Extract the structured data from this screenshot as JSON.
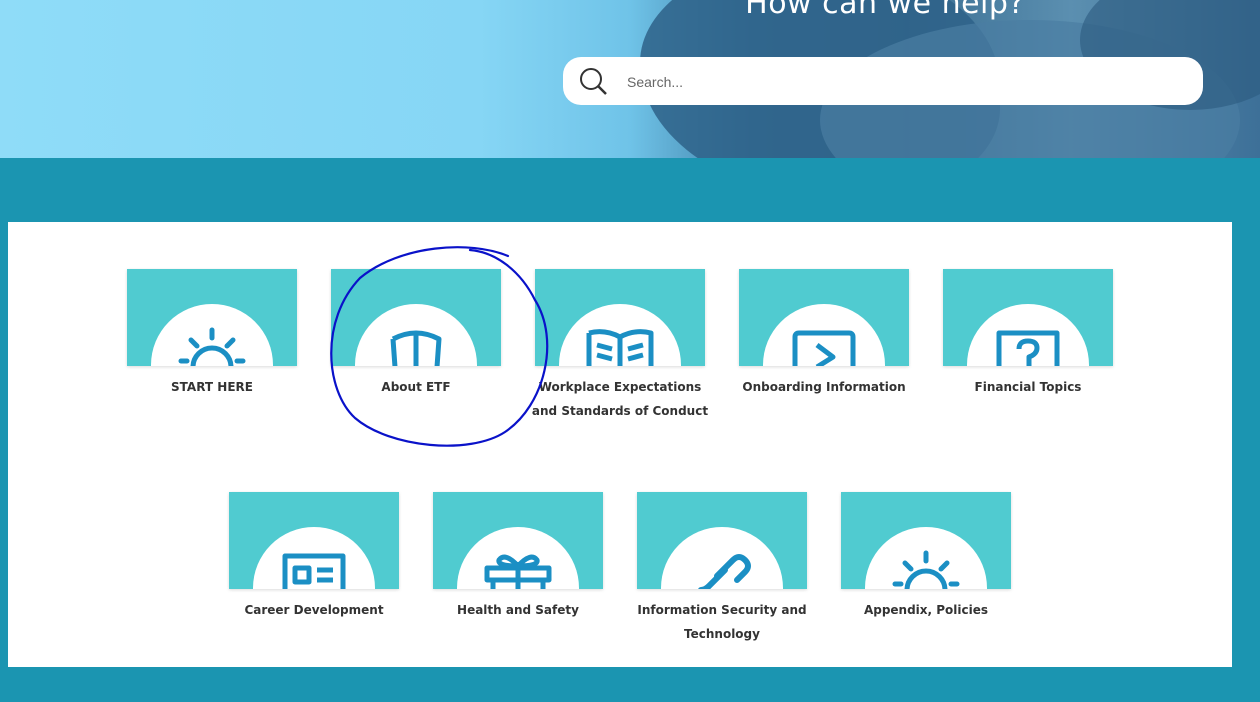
{
  "hero": {
    "title": "How can we help?"
  },
  "search": {
    "placeholder": "Search..."
  },
  "colors": {
    "tile": "#50cbd0",
    "icon": "#1b8fc4",
    "band": "#1b95b1",
    "annotation": "#0a12c9"
  },
  "cards": [
    {
      "label": "START HERE",
      "icon": "sun-icon"
    },
    {
      "label": "About ETF",
      "icon": "shield-icon"
    },
    {
      "label": "Workplace Expectations and Standards of Conduct",
      "icon": "open-book-icon"
    },
    {
      "label": "Onboarding Information",
      "icon": "play-screen-icon"
    },
    {
      "label": "Financial Topics",
      "icon": "question-icon"
    },
    {
      "label": "Career Development",
      "icon": "id-card-icon"
    },
    {
      "label": "Health and Safety",
      "icon": "gift-icon"
    },
    {
      "label": "Information Security and Technology",
      "icon": "link-icon"
    },
    {
      "label": "Appendix, Policies",
      "icon": "sun-icon"
    }
  ]
}
